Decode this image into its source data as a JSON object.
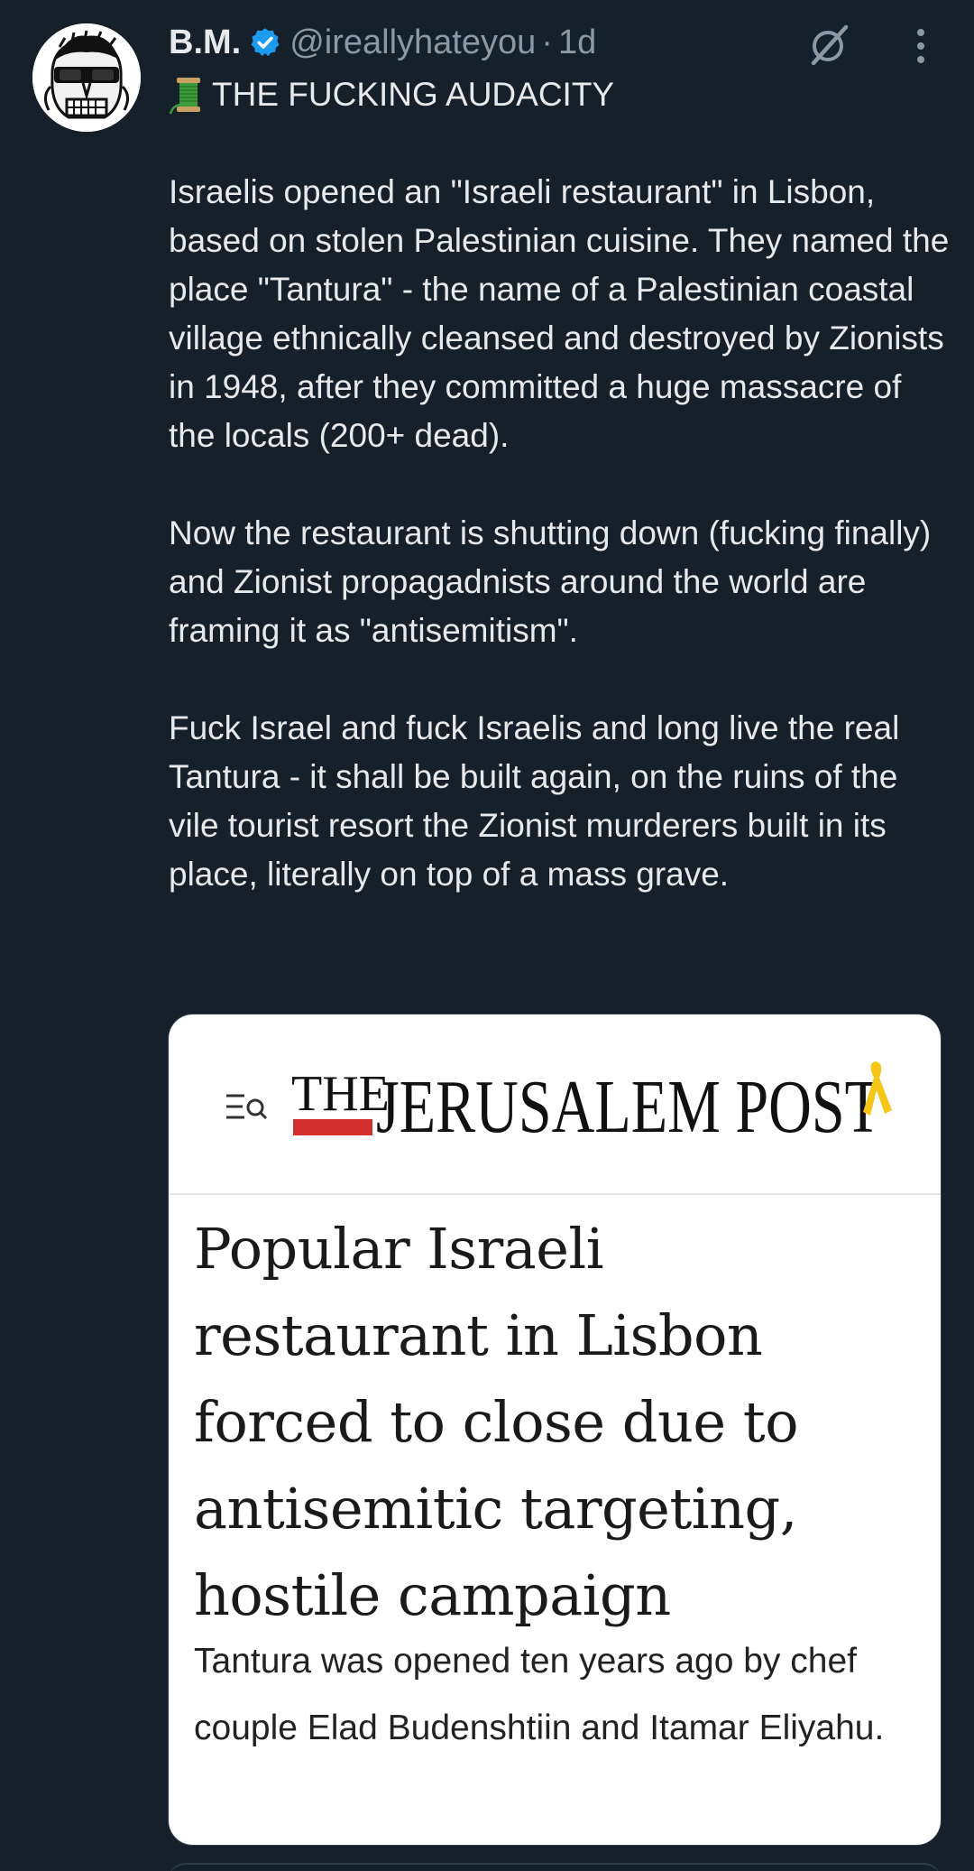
{
  "tweet": {
    "author": {
      "display_name": "B.M.",
      "handle": "@ireallyhateyou",
      "separator": "·",
      "time": "1d",
      "verified": true,
      "avatar_icon": "bw-skull-sunglasses-avatar"
    },
    "icons": {
      "verified": "verified-badge-icon",
      "grok": "grok-icon",
      "more": "more-vertical-icon",
      "spool": "spool-of-thread-emoji"
    },
    "text": {
      "line1": "THE FUCKING AUDACITY",
      "para1": "Israelis opened an \"Israeli restaurant\" in Lisbon, based on stolen Palestinian cuisine. They named the place \"Tantura\" - the name of a Palestinian coastal village ethnically cleansed and destroyed by Zionists in 1948, after they committed a huge massacre of the locals (200+ dead).",
      "para2": "Now the restaurant is shutting down (fucking finally) and Zionist propagadnists around the world are framing it as \"antisemitism\".",
      "para3": "Fuck Israel and fuck Israelis and long live the real Tantura - it shall be built again, on the ruins of the vile tourist resort the Zionist murderers built in its place, literally on top of a mass grave."
    }
  },
  "card": {
    "publication": "THE JERUSALEM POST",
    "logo_the": "THE",
    "logo_name": "JERUSALEM POST",
    "headline": "Popular Israeli restaurant in Lisbon forced to close due to antisemitic targeting, hostile campaign",
    "subtext": "Tantura was opened ten years ago by chef couple Elad Budenshtiin and Itamar Eliyahu."
  },
  "colors": {
    "background": "#15202b",
    "text_primary": "#e7e9ea",
    "text_secondary": "#8b98a5",
    "verified_blue": "#1d9bf0",
    "logo_red": "#d32f2f",
    "ribbon_yellow": "#f5c518"
  }
}
